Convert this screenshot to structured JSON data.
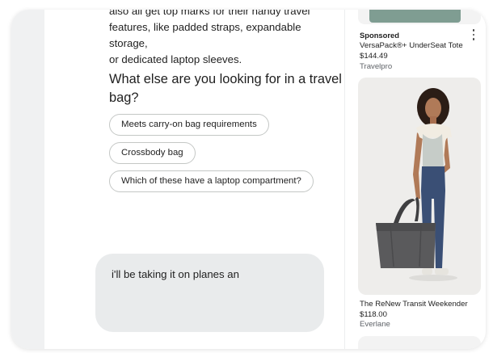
{
  "chat": {
    "answer_lines": [
      "also all get top marks for their handy travel",
      "features, like padded straps, expandable storage,",
      "or dedicated laptop sleeves."
    ],
    "followup_question": "What else are you looking for in a travel bag?",
    "chips": [
      "Meets carry-on bag requirements",
      "Crossbody bag",
      "Which of these have a laptop compartment?"
    ],
    "input_value": "i'll be taking it on planes an"
  },
  "shopping": {
    "products": [
      {
        "badge": "Sponsored",
        "name": "VersaPack®+ UnderSeat Tote",
        "price": "$144.49",
        "store": "Travelpro",
        "image_icon": "tote-bag-image"
      },
      {
        "name": "The ReNew Transit Weekender",
        "price": "$118.00",
        "store": "Everlane",
        "image_icon": "model-with-weekender-bag-image"
      }
    ],
    "menu_icon": "more-vert-icon"
  },
  "colors": {
    "input_bg": "#e9ebec",
    "chip_border": "#c4c7c5",
    "rail_bg": "#f0f1f2",
    "tote_green": "#7f9d92",
    "bag_gray": "#5a5a5c",
    "jeans_blue": "#3a4f75"
  }
}
